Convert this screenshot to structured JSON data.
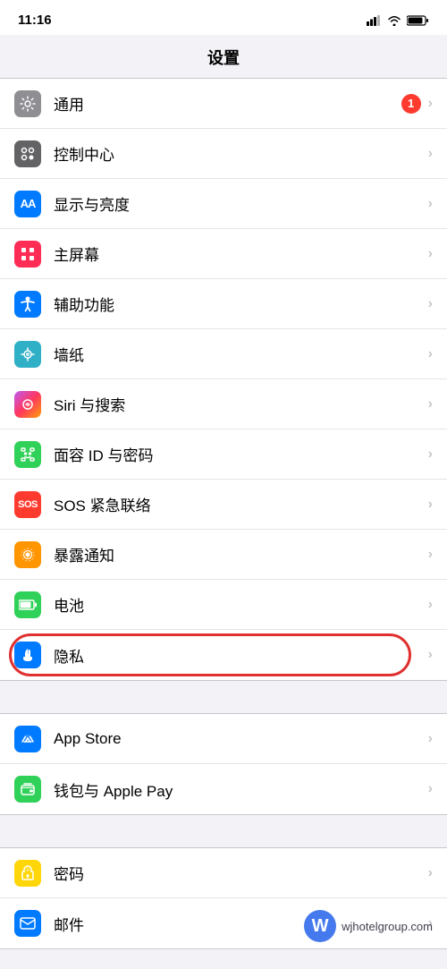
{
  "statusBar": {
    "time": "11:16",
    "locationIcon": true
  },
  "pageTitle": "设置",
  "sections": [
    {
      "id": "section1",
      "rows": [
        {
          "id": "general",
          "label": "通用",
          "iconBg": "icon-gray",
          "iconSymbol": "⚙️",
          "badge": "1",
          "chevron": true
        },
        {
          "id": "control",
          "label": "控制中心",
          "iconBg": "icon-gray2",
          "iconSymbol": "⊞",
          "badge": null,
          "chevron": true
        },
        {
          "id": "display",
          "label": "显示与亮度",
          "iconBg": "icon-blue",
          "iconSymbol": "AA",
          "badge": null,
          "chevron": true
        },
        {
          "id": "homescreen",
          "label": "主屏幕",
          "iconBg": "icon-pink",
          "iconSymbol": "⊞",
          "badge": null,
          "chevron": true
        },
        {
          "id": "accessibility",
          "label": "辅助功能",
          "iconBg": "icon-blue",
          "iconSymbol": "♿",
          "badge": null,
          "chevron": true
        },
        {
          "id": "wallpaper",
          "label": "墙纸",
          "iconBg": "icon-teal",
          "iconSymbol": "✿",
          "badge": null,
          "chevron": true
        },
        {
          "id": "siri",
          "label": "Siri 与搜索",
          "iconBg": "icon-purple",
          "iconSymbol": "◎",
          "badge": null,
          "chevron": true
        },
        {
          "id": "faceid",
          "label": "面容 ID 与密码",
          "iconBg": "icon-green-face",
          "iconSymbol": "☺",
          "badge": null,
          "chevron": true
        },
        {
          "id": "sos",
          "label": "SOS 紧急联络",
          "iconBg": "icon-red-sos",
          "iconSymbol": "SOS",
          "badge": null,
          "chevron": true
        },
        {
          "id": "exposure",
          "label": "暴露通知",
          "iconBg": "icon-orange2",
          "iconSymbol": "✳",
          "badge": null,
          "chevron": true
        },
        {
          "id": "battery",
          "label": "电池",
          "iconBg": "icon-green-bat",
          "iconSymbol": "▬",
          "badge": null,
          "chevron": true
        },
        {
          "id": "privacy",
          "label": "隐私",
          "iconBg": "icon-blue-hand",
          "iconSymbol": "✋",
          "badge": null,
          "chevron": true,
          "highlighted": true
        }
      ]
    },
    {
      "id": "section2",
      "rows": [
        {
          "id": "appstore",
          "label": "App Store",
          "iconBg": "icon-blue-appstore",
          "iconSymbol": "A",
          "badge": null,
          "chevron": true
        },
        {
          "id": "wallet",
          "label": "钱包与 Apple Pay",
          "iconBg": "icon-green-wallet",
          "iconSymbol": "▤",
          "badge": null,
          "chevron": true
        }
      ]
    },
    {
      "id": "section3",
      "rows": [
        {
          "id": "passwords",
          "label": "密码",
          "iconBg": "icon-yellow",
          "iconSymbol": "🔑",
          "badge": null,
          "chevron": true
        },
        {
          "id": "mail",
          "label": "邮件",
          "iconBg": "icon-blue-mail",
          "iconSymbol": "✉",
          "badge": null,
          "chevron": true
        }
      ]
    }
  ]
}
